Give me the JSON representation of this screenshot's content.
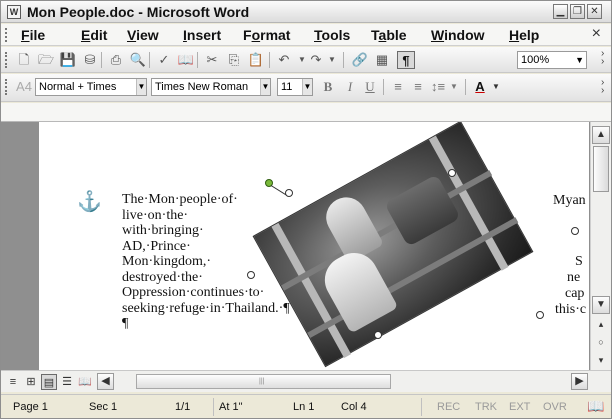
{
  "window": {
    "title": "Mon People.doc - Microsoft Word",
    "app_icon": "W",
    "minimize_icon": "minimize-icon",
    "restore_icon": "restore-icon",
    "close_icon": "close-icon"
  },
  "menu": {
    "items": [
      {
        "mnemonic": "F",
        "rest": "ile"
      },
      {
        "mnemonic": "E",
        "rest": "dit"
      },
      {
        "mnemonic": "V",
        "rest": "iew"
      },
      {
        "mnemonic": "I",
        "rest": "nsert"
      },
      {
        "prefix": "F",
        "mnemonic": "o",
        "rest": "rmat"
      },
      {
        "mnemonic": "T",
        "rest": "ools"
      },
      {
        "prefix": "T",
        "mnemonic": "a",
        "rest": "ble"
      },
      {
        "mnemonic": "W",
        "rest": "indow"
      },
      {
        "mnemonic": "H",
        "rest": "elp"
      }
    ],
    "close_doc": "×"
  },
  "standard_toolbar": {
    "pilcrow": "¶",
    "zoom": "100%"
  },
  "formatting_toolbar": {
    "style": "Normal + Times",
    "font": "Times New Roman",
    "size": "11",
    "bold": "B",
    "italic": "I",
    "underline": "U",
    "font_color": "A"
  },
  "document": {
    "paragraph_lines": [
      "The·Mon·people·of·",
      "live·on·the·",
      "with·bringing·",
      "AD,·Prince·",
      "Mon·kingdom,·",
      "destroyed·the·",
      "Oppression·continues·to·",
      "seeking·refuge·in·Thailand.·¶",
      "¶"
    ],
    "right_fragments": [
      "Myan",
      "S",
      "ne",
      "cap",
      "this·c"
    ]
  },
  "status": {
    "page": "Page 1",
    "sec": "Sec 1",
    "pages": "1/1",
    "at": "At 1\"",
    "ln": "Ln 1",
    "col": "Col 4",
    "rec": "REC",
    "trk": "TRK",
    "ext": "EXT",
    "ovr": "OVR"
  }
}
